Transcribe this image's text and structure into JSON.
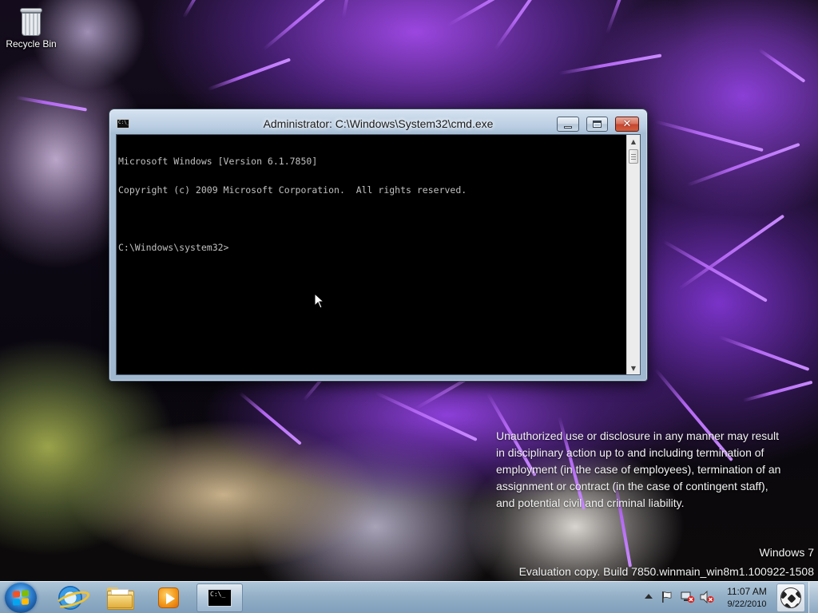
{
  "desktop": {
    "icons": [
      {
        "label": "Recycle Bin",
        "icon": "recycle-bin-icon"
      }
    ],
    "watermark": {
      "legal_lines": [
        "Unauthorized use or disclosure in any manner may result",
        "in disciplinary action up to and including termination of",
        "employment (in the case of employees), termination of an",
        "assignment or contract (in the case of contingent staff),",
        "and potential civil and criminal liability."
      ],
      "os_name": "Windows 7",
      "build": "Evaluation copy. Build 7850.winmain_win8m1.100922-1508"
    }
  },
  "cmd_window": {
    "title": "Administrator: C:\\Windows\\System32\\cmd.exe",
    "app_icon_text": "C:\\_",
    "lines": [
      "Microsoft Windows [Version 6.1.7850]",
      "Copyright (c) 2009 Microsoft Corporation.  All rights reserved.",
      "",
      "C:\\Windows\\system32>"
    ],
    "buttons": {
      "minimize": "minimize-icon",
      "maximize": "maximize-icon",
      "close": "✕"
    },
    "scroll": {
      "up": "▲",
      "down": "▼"
    }
  },
  "taskbar": {
    "start": {
      "icon": "windows-logo-icon"
    },
    "pinned": [
      {
        "name": "Internet Explorer",
        "icon": "ie-icon"
      },
      {
        "name": "Windows Explorer",
        "icon": "folder-icon"
      },
      {
        "name": "Windows Media Player",
        "icon": "media-player-icon"
      },
      {
        "name": "cmd.exe",
        "icon": "cmd-icon",
        "icon_text": "C:\\_",
        "active": true
      }
    ],
    "tray": {
      "icons": [
        "tray-expand-icon",
        "action-center-flag-icon",
        "network-disconnected-icon",
        "volume-muted-icon"
      ],
      "time": "11:07 AM",
      "date": "9/22/2010"
    },
    "show_desktop_icon": "soccer-ball-icon"
  },
  "colors": {
    "console_bg": "#000000",
    "console_text": "#c0c0c0",
    "close_red": "#c44630",
    "watermark_text": "#f2f2f2"
  }
}
